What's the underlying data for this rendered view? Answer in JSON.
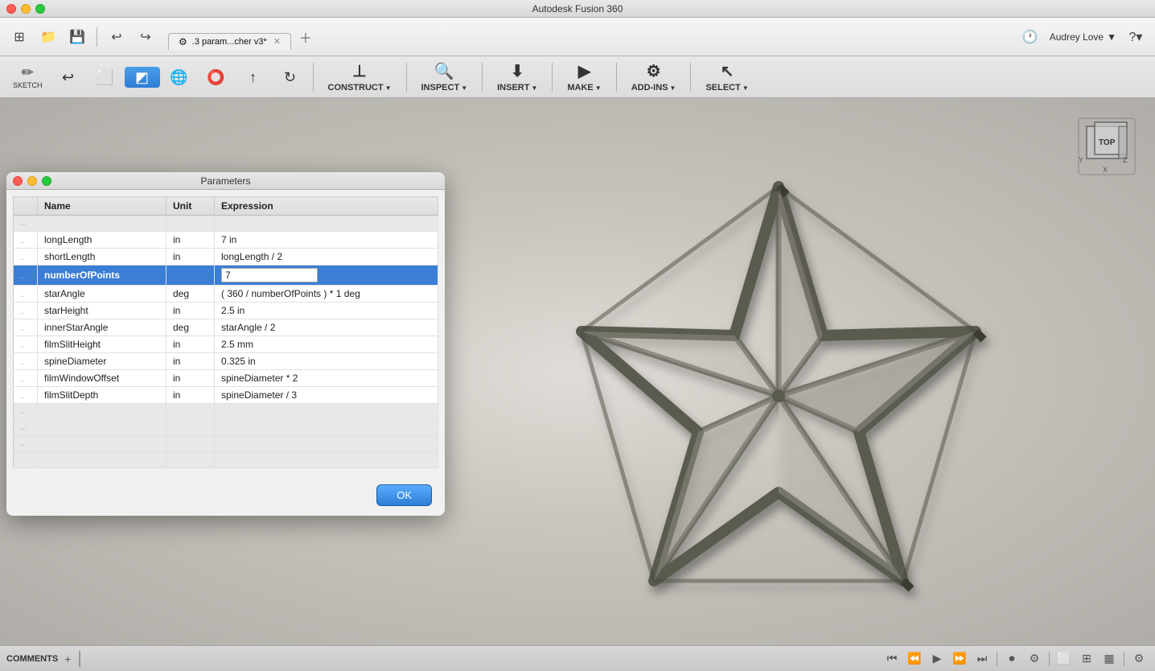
{
  "app": {
    "title": "Autodesk Fusion 360",
    "tab_label": ".3 param...cher v3*",
    "user": "Audrey Love"
  },
  "toolbar": {
    "save_label": "💾",
    "undo_label": "↩",
    "redo_label": "↪"
  },
  "secondary_toolbar": {
    "construct_label": "CONSTRUCT",
    "inspect_label": "INSPECT",
    "insert_label": "INSERT",
    "make_label": "MAKE",
    "addins_label": "ADD-INS",
    "select_label": "SELECT"
  },
  "dialog": {
    "title": "Parameters",
    "columns": [
      "Name",
      "Unit",
      "Expression"
    ],
    "rows": [
      {
        "type": "group",
        "name": "...",
        "unit": "",
        "expression": ""
      },
      {
        "type": "data",
        "name": "longLength",
        "unit": "in",
        "expression": "7 in"
      },
      {
        "type": "data",
        "name": "shortLength",
        "unit": "in",
        "expression": "longLength / 2"
      },
      {
        "type": "selected",
        "name": "numberOfPoints",
        "unit": "",
        "expression": "7"
      },
      {
        "type": "data",
        "name": "starAngle",
        "unit": "deg",
        "expression": "( 360 / numberOfPoints ) * 1 deg"
      },
      {
        "type": "data",
        "name": "starHeight",
        "unit": "in",
        "expression": "2.5 in"
      },
      {
        "type": "data",
        "name": "innerStarAngle",
        "unit": "deg",
        "expression": "starAngle / 2"
      },
      {
        "type": "data",
        "name": "filmSlitHeight",
        "unit": "in",
        "expression": "2.5 mm"
      },
      {
        "type": "data",
        "name": "spineDiameter",
        "unit": "in",
        "expression": "0.325 in"
      },
      {
        "type": "data",
        "name": "filmWindowOffset",
        "unit": "in",
        "expression": "spineDiameter * 2"
      },
      {
        "type": "data",
        "name": "filmSlitDepth",
        "unit": "in",
        "expression": "spineDiameter / 3"
      },
      {
        "type": "group",
        "name": "..",
        "unit": "",
        "expression": ""
      },
      {
        "type": "group",
        "name": "...",
        "unit": "",
        "expression": ""
      },
      {
        "type": "group",
        "name": "..",
        "unit": "",
        "expression": ""
      },
      {
        "type": "group",
        "name": ".",
        "unit": "",
        "expression": ""
      }
    ],
    "ok_label": "OK"
  },
  "comments": {
    "label": "COMMENTS",
    "add_icon": "+",
    "panel_icon": "⊟"
  },
  "viewport": {
    "axis_labels": [
      "X",
      "Y",
      "Z",
      "TOP"
    ]
  }
}
